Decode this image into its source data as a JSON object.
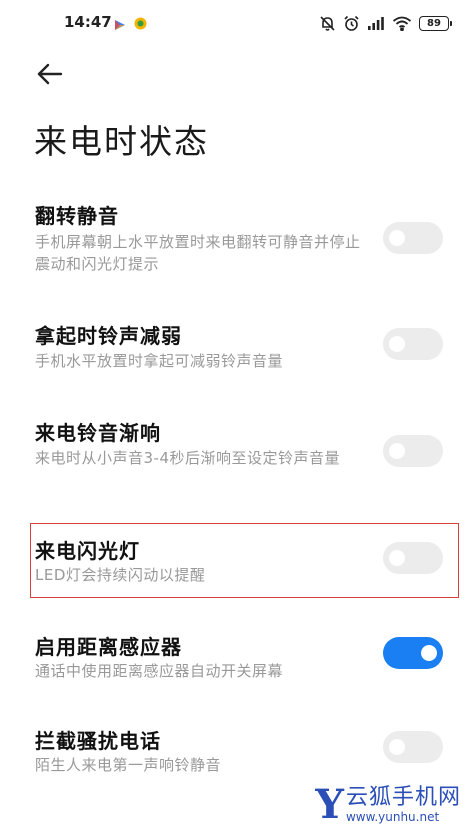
{
  "status_bar": {
    "time": "14:47",
    "battery": "89"
  },
  "page": {
    "title": "来电时状态"
  },
  "settings": [
    {
      "title": "翻转静音",
      "desc": "手机屏幕朝上水平放置时来电翻转可静音并停止震动和闪光灯提示",
      "enabled": false
    },
    {
      "title": "拿起时铃声减弱",
      "desc": "手机水平放置时拿起可减弱铃声音量",
      "enabled": false
    },
    {
      "title": "来电铃音渐响",
      "desc": "来电时从小声音3-4秒后渐响至设定铃声音量",
      "enabled": false
    },
    {
      "title": "来电闪光灯",
      "desc": "LED灯会持续闪动以提醒",
      "enabled": false
    },
    {
      "title": "启用距离感应器",
      "desc": "通话中使用距离感应器自动开关屏幕",
      "enabled": true
    },
    {
      "title": "拦截骚扰电话",
      "desc": "陌生人来电第一声响铃静音",
      "enabled": false
    }
  ],
  "watermark": {
    "logo": "Y",
    "name": "云狐手机网",
    "url": "www.yunhu.net"
  },
  "colors": {
    "accent": "#1a7ff3",
    "highlight": "#d9403a",
    "toggle_off": "#ececec"
  }
}
